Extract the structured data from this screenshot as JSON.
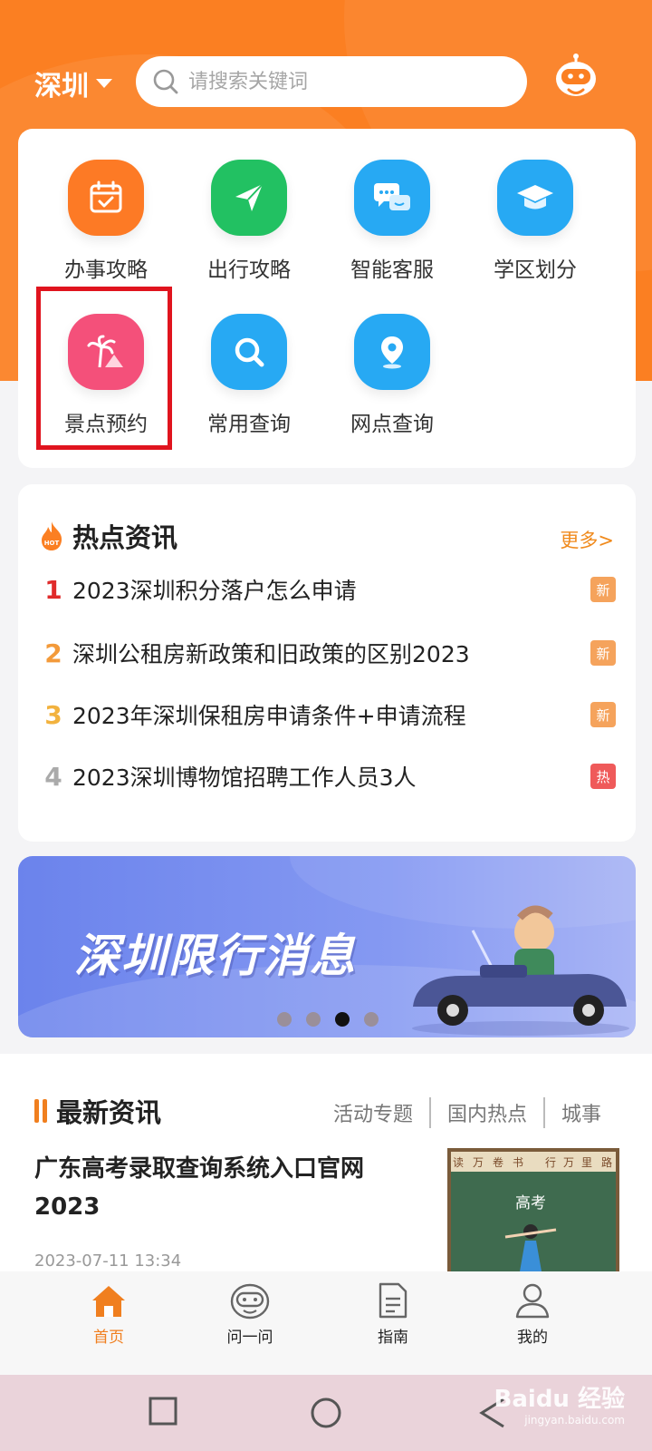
{
  "header": {
    "city": "深圳",
    "search_placeholder": "请搜索关键词"
  },
  "services": [
    {
      "label": "办事攻略",
      "icon": "calendar-check-icon",
      "color": "#fd7a25"
    },
    {
      "label": "出行攻略",
      "icon": "paper-plane-icon",
      "color": "#22c162"
    },
    {
      "label": "智能客服",
      "icon": "chat-bubbles-icon",
      "color": "#27a9f3"
    },
    {
      "label": "学区划分",
      "icon": "graduation-cap-icon",
      "color": "#27a9f3"
    },
    {
      "label": "景点预约",
      "icon": "palm-tree-icon",
      "color": "#f4507a"
    },
    {
      "label": "常用查询",
      "icon": "search-icon",
      "color": "#27a9f3"
    },
    {
      "label": "网点查询",
      "icon": "location-pin-icon",
      "color": "#27a9f3"
    }
  ],
  "hot_news": {
    "title": "热点资讯",
    "hot_badge": "HOT",
    "more": "更多>",
    "items": [
      {
        "rank": "1",
        "text": "2023深圳积分落户怎么申请",
        "tag": "新",
        "rank_color": "#e02b2b",
        "tag_color": "#f5a35c"
      },
      {
        "rank": "2",
        "text": "深圳公租房新政策和旧政策的区别2023",
        "tag": "新",
        "rank_color": "#f39a3a",
        "tag_color": "#f5a35c"
      },
      {
        "rank": "3",
        "text": "2023年深圳保租房申请条件+申请流程",
        "tag": "新",
        "rank_color": "#f2b23e",
        "tag_color": "#f5a35c"
      },
      {
        "rank": "4",
        "text": "2023深圳博物馆招聘工作人员3人",
        "tag": "热",
        "rank_color": "#aaaaaa",
        "tag_color": "#ef5a5a"
      }
    ]
  },
  "banner": {
    "title": "深圳限行消息",
    "dots": 4,
    "active_dot": 3
  },
  "latest": {
    "title": "最新资讯",
    "tabs": [
      "活动专题",
      "国内热点",
      "城事"
    ],
    "article_title": "广东高考录取查询系统入口官网2023",
    "article_date": "2023-07-11 13:34",
    "thumb_labels": [
      "读",
      "万",
      "卷",
      "书",
      "行",
      "万",
      "里",
      "路"
    ],
    "thumb_board_text": "高考"
  },
  "tabbar": [
    {
      "label": "首页",
      "icon": "home-icon",
      "active": true
    },
    {
      "label": "问一问",
      "icon": "robot-icon",
      "active": false
    },
    {
      "label": "指南",
      "icon": "document-icon",
      "active": false
    },
    {
      "label": "我的",
      "icon": "user-icon",
      "active": false
    }
  ],
  "watermark": {
    "brand": "Baidu 经验",
    "url": "jingyan.baidu.com"
  },
  "colors": {
    "brand_orange": "#fb7f22",
    "highlight_red": "#e0141e"
  }
}
